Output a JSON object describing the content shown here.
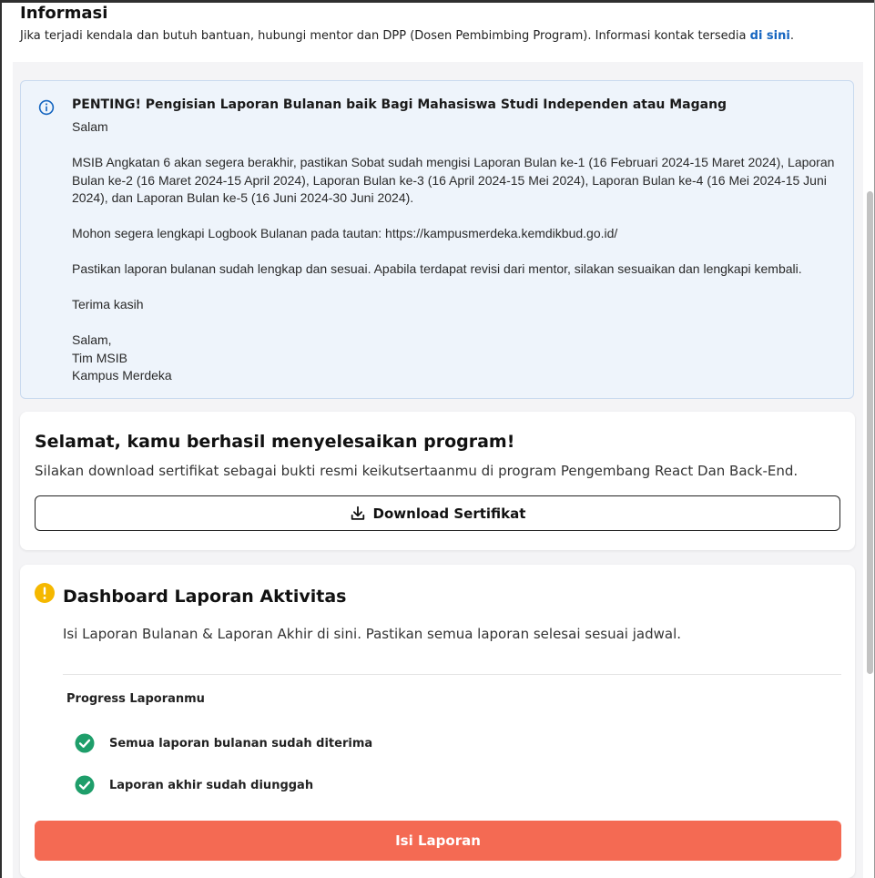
{
  "info": {
    "title": "Informasi",
    "subtitle": "Jika terjadi kendala dan butuh bantuan, hubungi mentor dan DPP (Dosen Pembimbing Program). Informasi kontak tersedia ",
    "link": "di sini",
    "suffix": "."
  },
  "alert": {
    "icon": "info-icon",
    "title": "PENTING! Pengisian Laporan Bulanan baik Bagi Mahasiswa Studi Independen atau Magang",
    "body": "Salam\n\nMSIB Angkatan 6 akan segera berakhir, pastikan Sobat sudah mengisi Laporan Bulan ke-1 (16 Februari 2024-15 Maret 2024), Laporan Bulan ke-2 (16 Maret 2024-15 April 2024), Laporan Bulan ke-3 (16 April 2024-15 Mei 2024), Laporan Bulan ke-4 (16 Mei 2024-15 Juni 2024), dan Laporan Bulan ke-5 (16 Juni 2024-30 Juni 2024).\n\nMohon segera lengkapi Logbook Bulanan pada tautan: https://kampusmerdeka.kemdikbud.go.id/\n\nPastikan laporan bulanan sudah lengkap dan sesuai. Apabila terdapat revisi dari mentor, silakan sesuaikan dan lengkapi kembali.\n\nTerima kasih\n\nSalam,\nTim MSIB\nKampus Merdeka"
  },
  "certificate": {
    "title": "Selamat, kamu berhasil menyelesaikan program!",
    "description": "Silakan download sertifikat sebagai bukti resmi keikutsertaanmu di program Pengembang React Dan Back-End.",
    "button_label": "Download Sertifikat",
    "button_icon": "download-icon"
  },
  "dashboard": {
    "title": "Dashboard Laporan Aktivitas",
    "icon": "warning-icon",
    "description": "Isi Laporan Bulanan & Laporan Akhir di sini. Pastikan semua laporan selesai sesuai jadwal.",
    "progress_label": "Progress Laporanmu",
    "items": [
      {
        "label": "Semua laporan bulanan sudah diterima",
        "icon": "check-circle-icon"
      },
      {
        "label": "Laporan akhir sudah diunggah",
        "icon": "check-circle-icon"
      }
    ],
    "submit_label": "Isi Laporan"
  },
  "colors": {
    "accent": "#f46a53",
    "link": "#1565c0",
    "success": "#1e9e6a",
    "warning": "#f5b800",
    "info_bg": "#eef4fb"
  }
}
